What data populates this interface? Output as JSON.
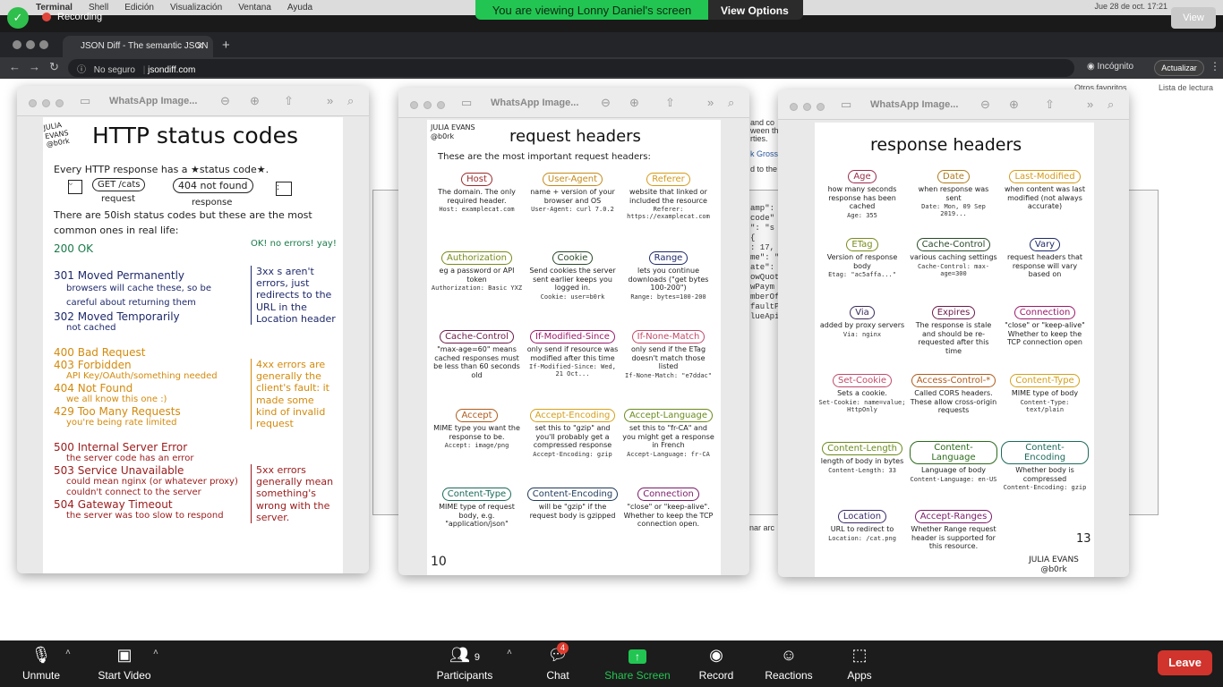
{
  "mac_menu": {
    "items": [
      "Terminal",
      "Shell",
      "Edición",
      "Visualización",
      "Ventana",
      "Ayuda"
    ],
    "datetime": "Jue 28 de oct. 17:21"
  },
  "zoom_top": {
    "recording_label": "Recording",
    "viewing": "You are viewing Lonny Daniel's screen",
    "view_options": "View Options",
    "view_button": "View"
  },
  "browser": {
    "tab_title": "JSON Diff - The semantic JSON",
    "security": "No seguro",
    "url": "jsondiff.com",
    "profile": "Incógnito",
    "update_button": "Actualizar",
    "bookmarks": [
      "Otros favoritos",
      "Lista de lectura"
    ],
    "peek_text": [
      "and co",
      "ween the",
      "rties.",
      "k Grossb",
      "d to the",
      "amp\": ",
      "code\"",
      "\": \"s",
      "{",
      ": 17,",
      "me\": \"",
      "ate\":",
      "owQuot",
      "wPaym",
      "mberOf",
      "faultP",
      "lueApi",
      "onar arc"
    ]
  },
  "windows": [
    {
      "title": "WhatsApp Image..."
    },
    {
      "title": "WhatsApp Image..."
    },
    {
      "title": "WhatsApp Image..."
    }
  ],
  "zine1": {
    "author": "JULIA EVANS @b0rk",
    "title": "HTTP status codes",
    "intro": "Every HTTP response has a ★status code★.",
    "bubble_request": "GET /cats",
    "label_request": "request",
    "bubble_response": "404 not found",
    "label_response": "response",
    "common": "There are 50ish status codes but these are the most common ones in real life:",
    "rows": [
      {
        "code": "200 OK",
        "desc": "",
        "color": "#1a7a4a"
      },
      {
        "code": "301 Moved Permanently",
        "desc": "browsers will cache these, so be careful about returning them",
        "color": "#1f2a6b"
      },
      {
        "code": "302 Moved Temporarily",
        "desc": "not cached",
        "color": "#1f2a6b"
      },
      {
        "code": "400 Bad Request",
        "desc": "",
        "color": "#d48a0c"
      },
      {
        "code": "403 Forbidden",
        "desc": "API Key/OAuth/something needed",
        "color": "#d48a0c"
      },
      {
        "code": "404 Not Found",
        "desc": "we all know this one :)",
        "color": "#d48a0c"
      },
      {
        "code": "429 Too Many Requests",
        "desc": "you're being rate limited",
        "color": "#d48a0c"
      },
      {
        "code": "500 Internal Server Error",
        "desc": "the server code has an error",
        "color": "#9b1b1b"
      },
      {
        "code": "503 Service Unavailable",
        "desc": "could mean nginx (or whatever proxy) couldn't connect to the server",
        "color": "#9b1b1b"
      },
      {
        "code": "504 Gateway Timeout",
        "desc": "the server was too slow to respond",
        "color": "#9b1b1b"
      }
    ],
    "note_ok": "OK! no errors! yay!",
    "note_3xx": "3xx s aren't errors, just redirects to the URL in the Location header",
    "note_4xx": "4xx errors are generally the client's fault: it made some kind of invalid request",
    "note_5xx": "5xx errors generally mean something's wrong with the server."
  },
  "zine2": {
    "author": "JULIA EVANS @b0rk",
    "title": "request headers",
    "intro": "These are the most important request headers:",
    "page": "10",
    "headers": [
      {
        "name": "Host",
        "color": "#9b2b2b",
        "desc": "The domain. The only required header.",
        "ex": "Host: examplecat.com"
      },
      {
        "name": "User-Agent",
        "color": "#c58a1a",
        "desc": "name + version of your browser and OS",
        "ex": "User-Agent: curl 7.0.2"
      },
      {
        "name": "Referer",
        "color": "#d49a1a",
        "desc": "website that linked or included the resource",
        "ex": "Referer: https://examplecat.com"
      },
      {
        "name": "Authorization",
        "color": "#7a8a1a",
        "desc": "eg a password or API token",
        "ex": "Authorization: Basic YXZ"
      },
      {
        "name": "Cookie",
        "color": "#2a4a2a",
        "desc": "Send cookies the server sent earlier keeps you logged in.",
        "ex": "Cookie: user=b0rk"
      },
      {
        "name": "Range",
        "color": "#1f2a6b",
        "desc": "lets you continue downloads (\"get bytes 100-200\")",
        "ex": "Range: bytes=100-200"
      },
      {
        "name": "Cache-Control",
        "color": "#6b1a4a",
        "desc": "\"max-age=60\" means cached responses must be less than 60 seconds old",
        "ex": ""
      },
      {
        "name": "If-Modified-Since",
        "color": "#9a1a6a",
        "desc": "only send if resource was modified after this time",
        "ex": "If-Modified-Since: Wed, 21 Oct..."
      },
      {
        "name": "If-None-Match",
        "color": "#c04a6a",
        "desc": "only send if the ETag doesn't match those listed",
        "ex": "If-None-Match: \"e7ddac\""
      },
      {
        "name": "Accept",
        "color": "#b05a1a",
        "desc": "MIME type you want the response to be.",
        "ex": "Accept: image/png"
      },
      {
        "name": "Accept-Encoding",
        "color": "#d4a01a",
        "desc": "set this to \"gzip\" and you'll probably get a compressed response",
        "ex": "Accept-Encoding: gzip"
      },
      {
        "name": "Accept-Language",
        "color": "#6a8a1a",
        "desc": "set this to \"fr-CA\" and you might get a response in French",
        "ex": "Accept-Language: fr-CA"
      },
      {
        "name": "Content-Type",
        "color": "#1a6a5a",
        "desc": "MIME type of request body, e.g. \"application/json\"",
        "ex": ""
      },
      {
        "name": "Content-Encoding",
        "color": "#1f3a5a",
        "desc": "will be \"gzip\" if the request body is gzipped",
        "ex": ""
      },
      {
        "name": "Connection",
        "color": "#7a1a6a",
        "desc": "\"close\" or \"keep-alive\". Whether to keep the TCP connection open.",
        "ex": ""
      }
    ]
  },
  "zine3": {
    "title": "response headers",
    "page": "13",
    "author": "JULIA EVANS @b0rk",
    "headers": [
      {
        "name": "Age",
        "color": "#9b2b4a",
        "desc": "how many seconds response has been cached",
        "ex": "Age: 355"
      },
      {
        "name": "Date",
        "color": "#b07a1a",
        "desc": "when response was sent",
        "ex": "Date: Mon, 09 Sep 2019..."
      },
      {
        "name": "Last-Modified",
        "color": "#d49a1a",
        "desc": "when content was last modified (not always accurate)",
        "ex": ""
      },
      {
        "name": "ETag",
        "color": "#7a8a1a",
        "desc": "Version of response body",
        "ex": "Etag: \"ac5affa...\""
      },
      {
        "name": "Cache-Control",
        "color": "#2a4a2a",
        "desc": "various caching settings",
        "ex": "Cache-Control: max-age=300"
      },
      {
        "name": "Vary",
        "color": "#1f2a6b",
        "desc": "request headers that response will vary based on",
        "ex": ""
      },
      {
        "name": "Via",
        "color": "#3a2a5a",
        "desc": "added by proxy servers",
        "ex": "Via: nginx"
      },
      {
        "name": "Expires",
        "color": "#6b1a4a",
        "desc": "The response is stale and should be re-requested after this time",
        "ex": ""
      },
      {
        "name": "Connection",
        "color": "#9a1a6a",
        "desc": "\"close\" or \"keep-alive\" Whether to keep the TCP connection open",
        "ex": ""
      },
      {
        "name": "Set-Cookie",
        "color": "#c04a6a",
        "desc": "Sets a cookie.",
        "ex": "Set-Cookie: name=value; HttpOnly"
      },
      {
        "name": "Access-Control-*",
        "color": "#b05a1a",
        "desc": "Called CORS headers. These allow cross-origin requests",
        "ex": ""
      },
      {
        "name": "Content-Type",
        "color": "#d4a01a",
        "desc": "MIME type of body",
        "ex": "Content-Type: text/plain"
      },
      {
        "name": "Content-Length",
        "color": "#6a8a1a",
        "desc": "length of body in bytes",
        "ex": "Content-Length: 33"
      },
      {
        "name": "Content-Language",
        "color": "#2a6a1a",
        "desc": "Language of body",
        "ex": "Content-Language: en-US"
      },
      {
        "name": "Content-Encoding",
        "color": "#1a6a5a",
        "desc": "Whether body is compressed",
        "ex": "Content-Encoding: gzip"
      },
      {
        "name": "Location",
        "color": "#3a2a6a",
        "desc": "URL to redirect to",
        "ex": "Location: /cat.png"
      },
      {
        "name": "Accept-Ranges",
        "color": "#7a1a6a",
        "desc": "Whether Range request header is supported for this resource.",
        "ex": ""
      }
    ]
  },
  "zoom_bottom": {
    "unmute": "Unmute",
    "start_video": "Start Video",
    "participants": "Participants",
    "participants_count": "9",
    "chat": "Chat",
    "chat_badge": "4",
    "share": "Share Screen",
    "record": "Record",
    "reactions": "Reactions",
    "apps": "Apps",
    "leave": "Leave"
  }
}
